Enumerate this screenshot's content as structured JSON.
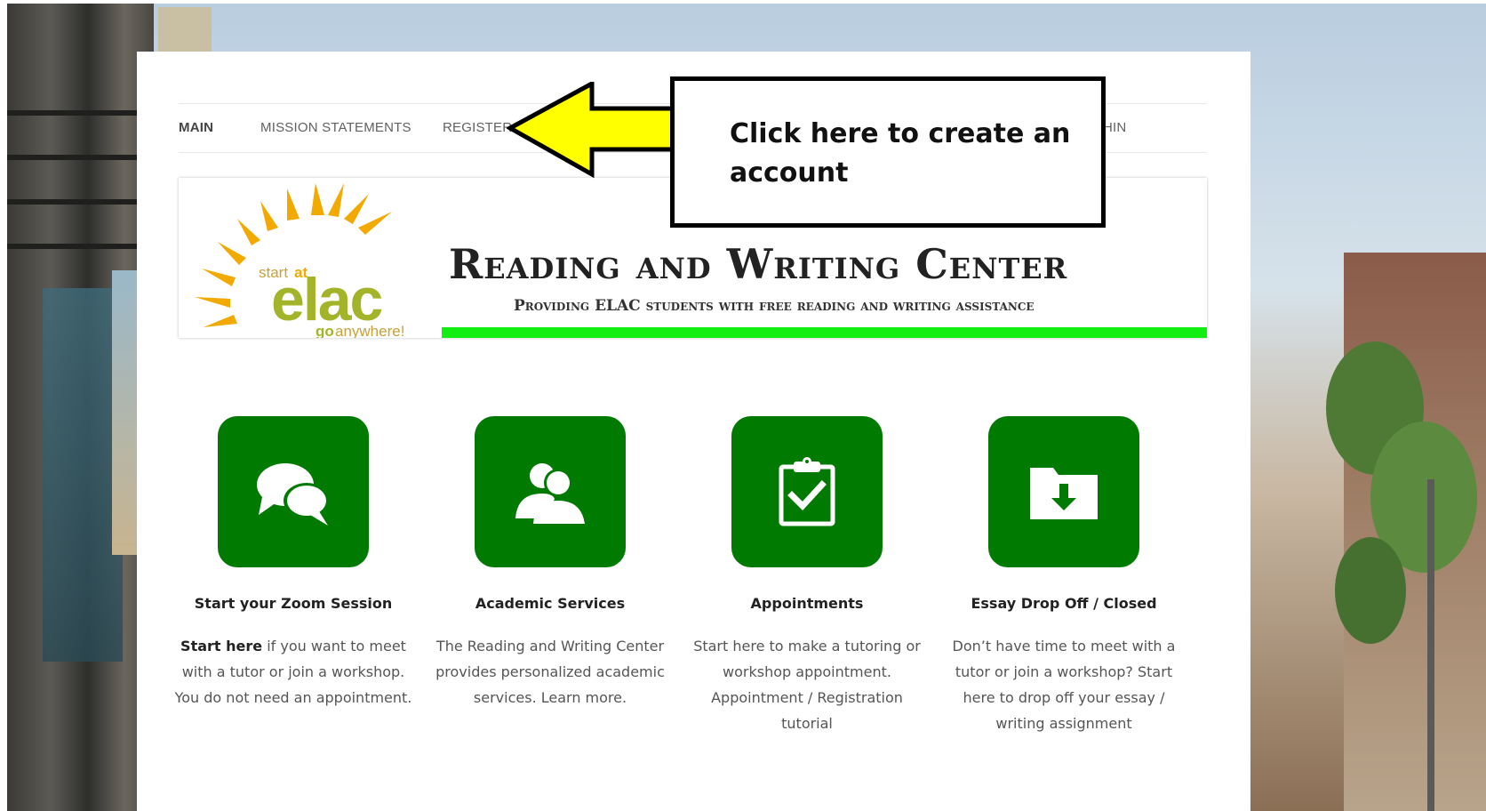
{
  "nav": {
    "items": [
      {
        "label": "MAIN"
      },
      {
        "label": "MISSION STATEMENTS"
      },
      {
        "label": "REGISTER"
      },
      {
        "label": "HIN"
      }
    ]
  },
  "callout": {
    "text": "Click here to create an account"
  },
  "hero": {
    "logo": {
      "start": "start",
      "at": "at",
      "brand": "elac",
      "go": "go",
      "anywhere": "anywhere!"
    },
    "title": "Reading and Writing Center",
    "subtitle": "Providing ELAC students with free reading and writing assistance"
  },
  "cards": [
    {
      "icon": "chat-bubbles-icon",
      "title": "Start your Zoom Session",
      "desc_bold": "Start here",
      "desc": " if you want to meet with a tutor or join a workshop. You do not need an appointment."
    },
    {
      "icon": "user-group-icon",
      "title": "Academic Services",
      "desc": "The Reading and Writing Center provides personalized academic services. Learn more."
    },
    {
      "icon": "clipboard-check-icon",
      "title": "Appointments",
      "desc": "Start here to make a tutoring or workshop appointment. Appointment / Registration tutorial"
    },
    {
      "icon": "folder-download-icon",
      "title": "Essay Drop Off / Closed",
      "desc": "Don’t have time to meet with a tutor or join a workshop? Start here to drop off your essay / writing assignment"
    }
  ],
  "colors": {
    "accent_green": "#007a00",
    "bar_green": "#12ee12",
    "arrow_yellow": "#ffff00"
  }
}
